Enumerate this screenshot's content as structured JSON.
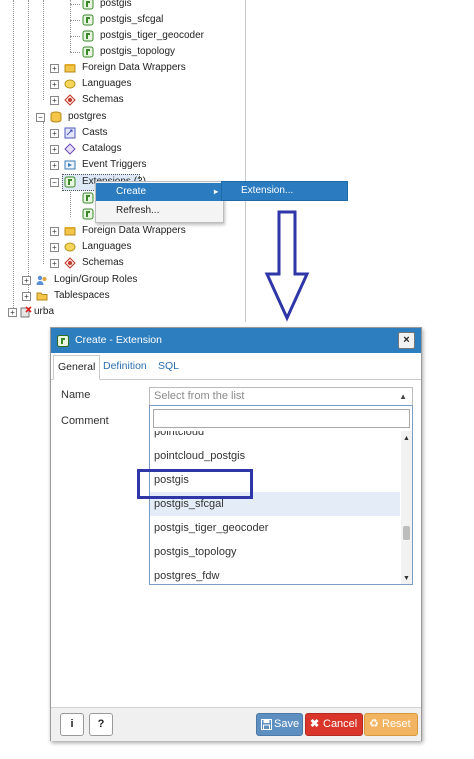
{
  "tree": {
    "items": [
      {
        "label": "postgis"
      },
      {
        "label": "postgis_sfcgal"
      },
      {
        "label": "postgis_tiger_geocoder"
      },
      {
        "label": "postgis_topology"
      },
      {
        "label": "Foreign Data Wrappers"
      },
      {
        "label": "Languages"
      },
      {
        "label": "Schemas"
      },
      {
        "label": "postgres"
      },
      {
        "label": "Casts"
      },
      {
        "label": "Catalogs"
      },
      {
        "label": "Event Triggers"
      },
      {
        "label": "Extensions (2)"
      },
      {
        "label": "Foreign Data Wrappers"
      },
      {
        "label": "Languages"
      },
      {
        "label": "Schemas"
      },
      {
        "label": "Login/Group Roles"
      },
      {
        "label": "Tablespaces"
      },
      {
        "label": "urba"
      }
    ]
  },
  "context_menu": {
    "create": "Create",
    "refresh": "Refresh...",
    "submenu_extension": "Extension..."
  },
  "dialog": {
    "title": "Create - Extension",
    "close": "×",
    "tabs": [
      "General",
      "Definition",
      "SQL"
    ],
    "name_label": "Name",
    "comment_label": "Comment",
    "select_placeholder": "Select from the list",
    "options": [
      "pointcloud",
      "pointcloud_postgis",
      "postgis",
      "postgis_sfcgal",
      "postgis_tiger_geocoder",
      "postgis_topology",
      "postgres_fdw"
    ],
    "buttons": {
      "info": "i",
      "help": "?",
      "save": "Save",
      "cancel": "Cancel",
      "reset": "Reset"
    }
  },
  "colors": {
    "accent": "#2c7ebf",
    "annotation": "#2e36a8",
    "cancel": "#d9352a",
    "reset": "#f2b461",
    "save": "#5d8fc0"
  }
}
